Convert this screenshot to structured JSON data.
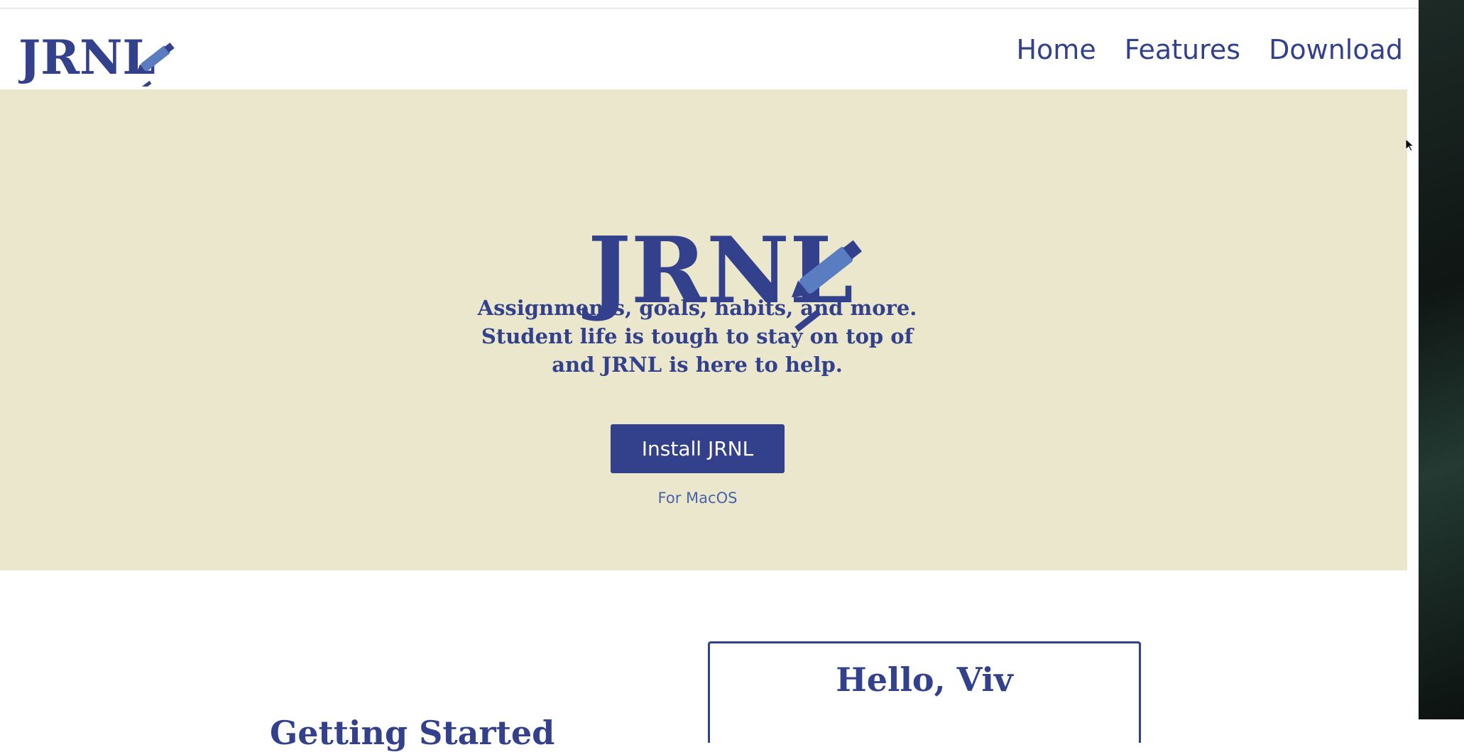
{
  "brand": {
    "logo_text": "JRNL",
    "primary_color": "#33418c",
    "hero_bg": "#ebe7cc"
  },
  "nav": {
    "items": [
      {
        "label": "Home"
      },
      {
        "label": "Features"
      },
      {
        "label": "Download"
      }
    ]
  },
  "hero": {
    "tagline_lines": [
      "Assignments, goals, habits, and more.",
      "Student life is tough to stay on top of",
      "and JRNL is here to help."
    ],
    "install_label": "Install JRNL",
    "platform_note": "For MacOS"
  },
  "section": {
    "getting_started_title": "Getting Started"
  },
  "preview_card": {
    "greeting": "Hello, Viv"
  },
  "icons": {
    "logo_mark": "pen-icon",
    "cursor": "mouse-pointer-icon"
  }
}
